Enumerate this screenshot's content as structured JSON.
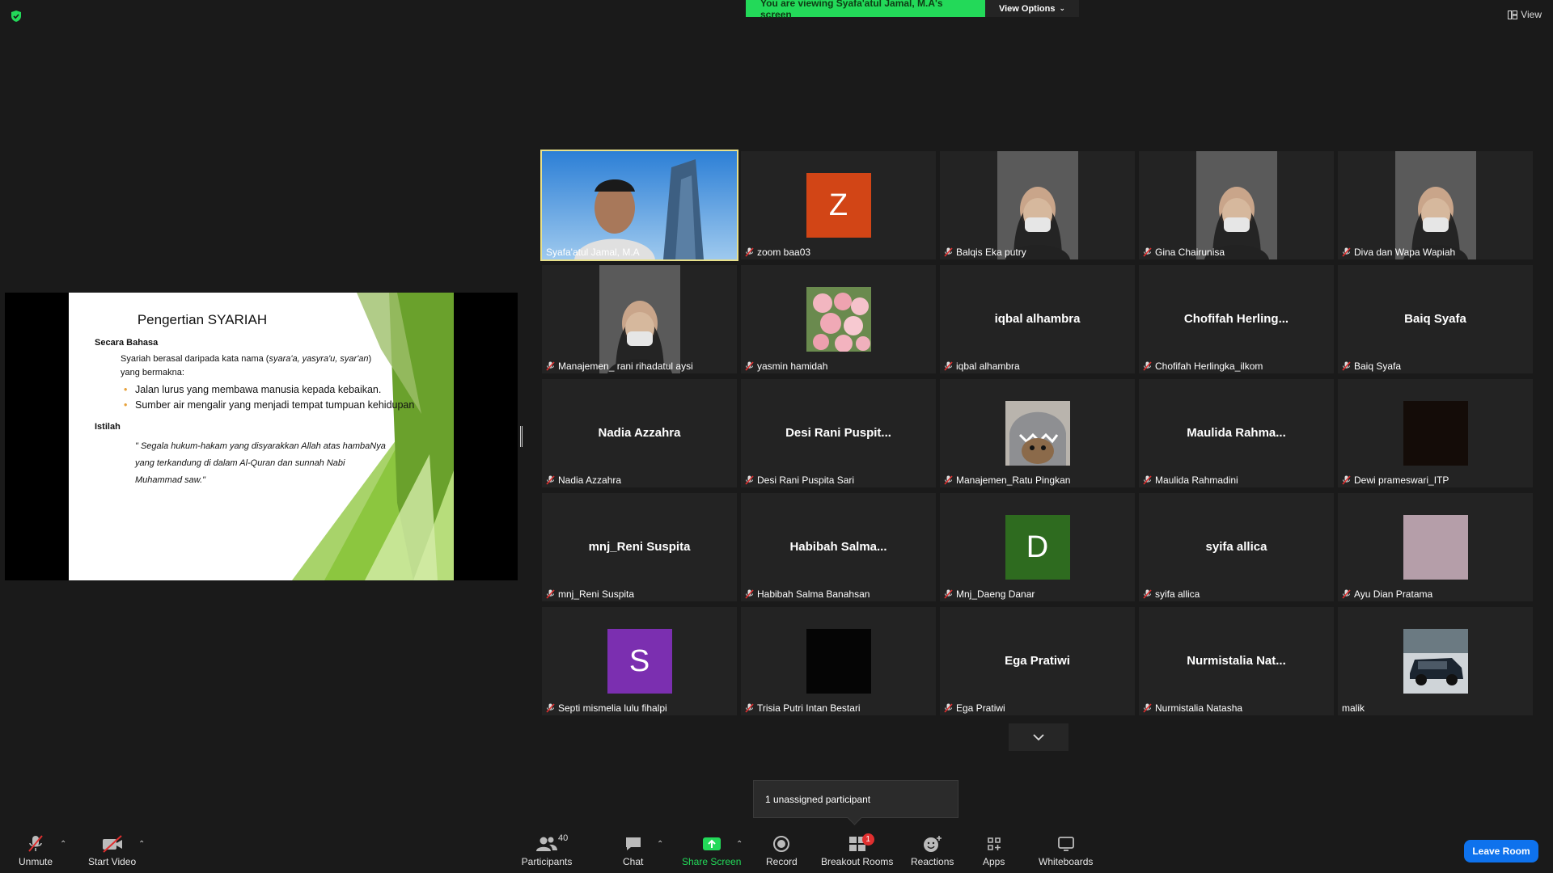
{
  "banner": {
    "viewing_text": "You are viewing Syafa'atul Jamal, M.A's screen",
    "view_options_label": "View Options"
  },
  "view_button_label": "View",
  "slide": {
    "title": "Pengertian SYARIAH",
    "heading1": "Secara Bahasa",
    "line1_prefix": "Syariah berasal daripada kata nama (",
    "line1_italic": "syara'a, yasyra'u, syar'an",
    "line1_suffix": ")",
    "line2": "yang bermakna:",
    "bullet1": "Jalan lurus yang membawa manusia kepada kebaikan.",
    "bullet2": "Sumber air mengalir yang menjadi tempat tumpuan kehidupan",
    "heading2": "Istilah",
    "quote": "\" Segala hukum-hakam yang disyarakkan Allah atas hambaNya yang terkandung di dalam Al-Quran dan sunnah Nabi Muhammad saw.\""
  },
  "participants": [
    {
      "name": "Syafa'atul Jamal, M.A",
      "display": "",
      "kind": "video-host",
      "muted": false
    },
    {
      "name": "zoom baa03",
      "display": "",
      "kind": "avatar",
      "letter": "Z",
      "color": "#d24516",
      "muted": true
    },
    {
      "name": "Balqis Eka putry",
      "display": "",
      "kind": "video",
      "muted": true
    },
    {
      "name": "Gina Chairunisa",
      "display": "",
      "kind": "video",
      "muted": true
    },
    {
      "name": "Diva dan Wapa Wapiah",
      "display": "",
      "kind": "video",
      "muted": true
    },
    {
      "name": "Manajemen_ rani rihadatul aysi",
      "display": "",
      "kind": "video",
      "muted": true
    },
    {
      "name": "yasmin hamidah",
      "display": "",
      "kind": "photo-flowers",
      "muted": true
    },
    {
      "name": "iqbal alhambra",
      "display": "iqbal alhambra",
      "kind": "text",
      "muted": true
    },
    {
      "name": "Chofifah Herlingka_ilkom",
      "display": "Chofifah  Herling...",
      "kind": "text",
      "muted": true
    },
    {
      "name": "Baiq Syafa",
      "display": "Baiq Syafa",
      "kind": "text",
      "muted": true
    },
    {
      "name": "Nadia Azzahra",
      "display": "Nadia Azzahra",
      "kind": "text",
      "muted": true
    },
    {
      "name": "Desi Rani Puspita Sari",
      "display": "Desi Rani Puspit...",
      "kind": "text",
      "muted": true
    },
    {
      "name": "Manajemen_Ratu Pingkan",
      "display": "",
      "kind": "photo-shark",
      "muted": true
    },
    {
      "name": "Maulida Rahmadini",
      "display": "Maulida  Rahma...",
      "kind": "text",
      "muted": true
    },
    {
      "name": "Dewi prameswari_ITP",
      "display": "",
      "kind": "photo-dark",
      "muted": true
    },
    {
      "name": "mnj_Reni Suspita",
      "display": "mnj_Reni Suspita",
      "kind": "text",
      "muted": true
    },
    {
      "name": "Habibah Salma Banahsan",
      "display": "Habibah  Salma...",
      "kind": "text",
      "muted": true
    },
    {
      "name": "Mnj_Daeng Danar",
      "display": "",
      "kind": "avatar",
      "letter": "D",
      "color": "#2e6b1f",
      "muted": true
    },
    {
      "name": "syifa allica",
      "display": "syifa allica",
      "kind": "text",
      "muted": true
    },
    {
      "name": "Ayu Dian Pratama",
      "display": "",
      "kind": "photo-mauve",
      "muted": true
    },
    {
      "name": "Septi mismelia lulu fihalpi",
      "display": "",
      "kind": "avatar",
      "letter": "S",
      "color": "#7b2fb0",
      "muted": true
    },
    {
      "name": "Trisia Putri Intan Bestari",
      "display": "",
      "kind": "photo-black",
      "muted": true
    },
    {
      "name": "Ega Pratiwi",
      "display": "Ega Pratiwi",
      "kind": "text",
      "muted": true
    },
    {
      "name": "Nurmistalia Natasha",
      "display": "Nurmistalia  Nat...",
      "kind": "text",
      "muted": true
    },
    {
      "name": "malik",
      "display": "",
      "kind": "photo-car",
      "muted": false
    }
  ],
  "tooltip": "1 unassigned participant",
  "toolbar": {
    "unmute": "Unmute",
    "start_video": "Start Video",
    "participants": "Participants",
    "participants_count": "40",
    "chat": "Chat",
    "share_screen": "Share Screen",
    "record": "Record",
    "breakout_rooms": "Breakout Rooms",
    "breakout_badge": "1",
    "reactions": "Reactions",
    "apps": "Apps",
    "whiteboards": "Whiteboards",
    "leave": "Leave Room"
  },
  "colors": {
    "accent_green": "#23d959",
    "leave_blue": "#0e72ed",
    "active_speaker": "#e8e08a"
  }
}
